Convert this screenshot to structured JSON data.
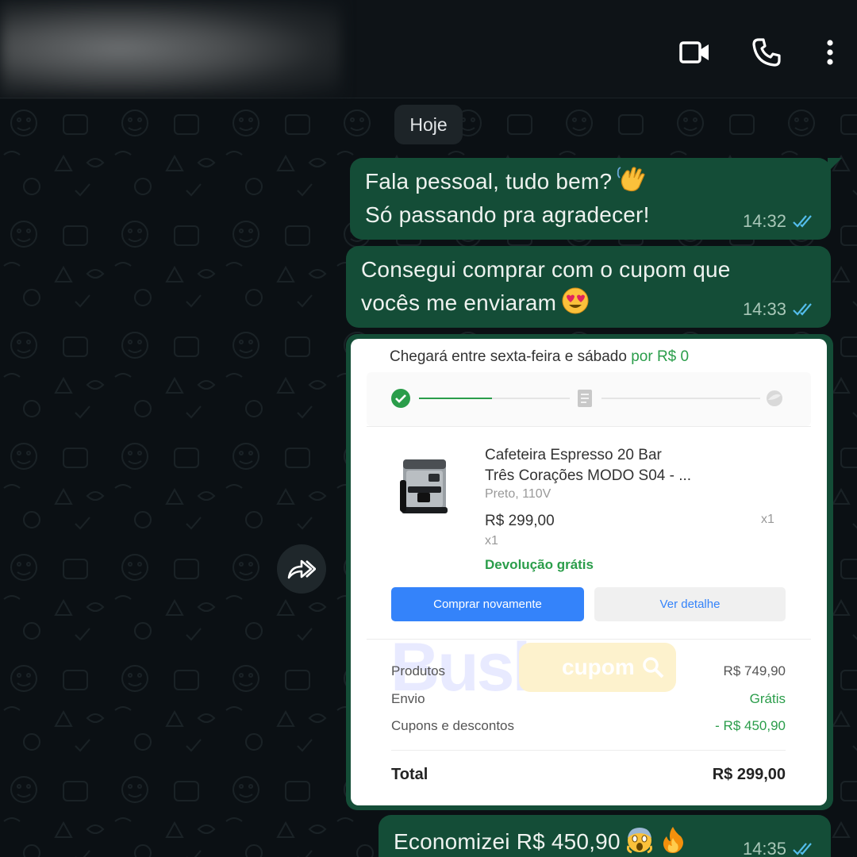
{
  "header": {
    "contact_name": "",
    "icons": [
      "video-call-icon",
      "voice-call-icon",
      "more-options-icon"
    ]
  },
  "chat": {
    "date_chip": "Hoje",
    "messages": [
      {
        "line1": "Fala pessoal, tudo bem?",
        "line2": "Só passando pra agradecer!",
        "emoji": "waving-hand",
        "time": "14:32",
        "status": "read"
      },
      {
        "line1": "Consegui comprar com o cupom que",
        "line2": "vocês me enviaram",
        "emoji": "heart-eyes-face",
        "time": "14:33",
        "status": "read"
      },
      {
        "text": "Economizei R$ 450,90",
        "emojis": [
          "screaming-face",
          "fire"
        ],
        "time": "14:35",
        "status": "read"
      }
    ]
  },
  "order_screenshot": {
    "delivery_text": "Chegará entre sexta-feira e sábado",
    "delivery_price": "por R$ 0",
    "product": {
      "title_line1": "Cafeteira Espresso 20 Bar",
      "title_line2": "Três Corações MODO S04 - ...",
      "variant": "Preto, 110V",
      "price": "R$ 299,00",
      "qty": "x1",
      "qty_right": "x1",
      "return_label": "Devolução grátis"
    },
    "buttons": {
      "buy_again": "Comprar novamente",
      "details": "Ver detalhe"
    },
    "summary": {
      "products_label": "Produtos",
      "products_value": "R$ 749,90",
      "shipping_label": "Envio",
      "shipping_value": "Grátis",
      "discount_label": "Cupons e descontos",
      "discount_value": "- R$ 450,90",
      "total_label": "Total",
      "total_value": "R$ 299,00"
    },
    "watermark": {
      "big": "Busk",
      "pill": "cupom"
    }
  },
  "colors": {
    "bubble_out": "#144d37",
    "read_ticks": "#53bdeb",
    "accent_green": "#2a9d4a",
    "button_blue": "#3483fa"
  }
}
